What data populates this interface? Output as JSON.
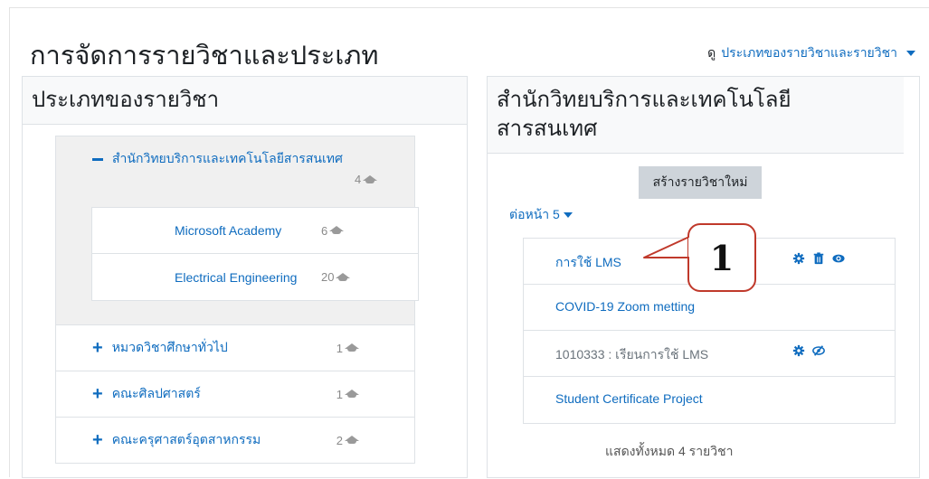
{
  "page": {
    "title": "การจัดการรายวิชาและประเภท",
    "view_prefix": "ดู",
    "view_link": "ประเภทของรายวิชาและรายวิชา"
  },
  "left_panel": {
    "heading": "ประเภทของรายวิชา",
    "expanded_category": {
      "label": "สำนักวิทยบริการและเทคโนโลยีสารสนเทศ",
      "count": "4"
    },
    "subcategories": [
      {
        "label": "Microsoft Academy",
        "count": "6"
      },
      {
        "label": "Electrical Engineering",
        "count": "20"
      }
    ],
    "categories": [
      {
        "label": "หมวดวิชาศึกษาทั่วไป",
        "count": "1"
      },
      {
        "label": "คณะศิลปศาสตร์",
        "count": "1"
      },
      {
        "label": "คณะครุศาสตร์อุตสาหกรรม",
        "count": "2"
      }
    ]
  },
  "right_panel": {
    "heading": "สำนักวิทยบริการและเทคโนโลยีสารสนเทศ",
    "create_button": "สร้างรายวิชาใหม่",
    "per_page": "ต่อหน้า 5",
    "courses": [
      {
        "name": "การใช้ LMS",
        "visible": true
      },
      {
        "name": "COVID-19 Zoom metting",
        "visible": true
      },
      {
        "name": "1010333 : เรียนการใช้ LMS",
        "visible": false
      },
      {
        "name": "Student Certificate Project",
        "visible": true
      }
    ],
    "total_text": "แสดงทั้งหมด 4 รายวิชา"
  },
  "callout": {
    "label": "1"
  },
  "colors": {
    "link": "#0f6cbf",
    "callout_border": "#c0392b",
    "header_bg": "#f8f9fa"
  }
}
